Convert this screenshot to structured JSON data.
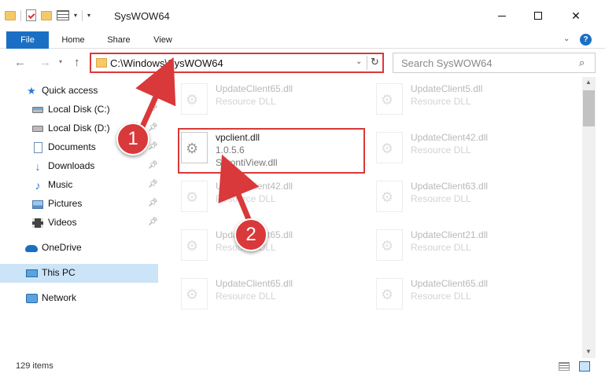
{
  "window": {
    "title": "SysWOW64",
    "controls": {
      "minimize": "minimize",
      "maximize": "maximize",
      "close": "✕"
    }
  },
  "ribbon": {
    "tabs": [
      {
        "label": "File",
        "active": true
      },
      {
        "label": "Home"
      },
      {
        "label": "Share"
      },
      {
        "label": "View"
      }
    ],
    "help_label": "?"
  },
  "navbar": {
    "back": "←",
    "forward": "→",
    "recent": "▾",
    "up": "↑",
    "address": "C:\\Windows\\SysWOW64",
    "address_dropdown": "⌄",
    "refresh": "↻",
    "search_placeholder": "Search SysWOW64",
    "search_icon": "⌕"
  },
  "sidebar": {
    "items": [
      {
        "label": "Quick access",
        "icon": "star-icon"
      },
      {
        "label": "Local Disk (C:)",
        "icon": "disk-icon",
        "pinned": true
      },
      {
        "label": "Local Disk (D:)",
        "icon": "disk-icon",
        "pinned": true
      },
      {
        "label": "Documents",
        "icon": "document-icon",
        "pinned": true
      },
      {
        "label": "Downloads",
        "icon": "download-icon",
        "pinned": true
      },
      {
        "label": "Music",
        "icon": "music-icon",
        "pinned": true
      },
      {
        "label": "Pictures",
        "icon": "pictures-icon",
        "pinned": true
      },
      {
        "label": "Videos",
        "icon": "video-icon",
        "pinned": true
      },
      {
        "label": "OneDrive",
        "icon": "cloud-icon"
      },
      {
        "label": "This PC",
        "icon": "computer-icon",
        "selected": true
      },
      {
        "label": "Network",
        "icon": "network-icon"
      }
    ]
  },
  "files": [
    {
      "name": "UpdateClient65.dll",
      "type": "Resource DLL",
      "faded": true
    },
    {
      "name": "UpdateClient5.dll",
      "type": "Resource DLL",
      "faded": true
    },
    {
      "name": "vpclient.dll",
      "type": "1.0.5.6",
      "desc": "SorontiView.dll",
      "faded": false
    },
    {
      "name": "UpdateClient42.dll",
      "type": "Resource DLL",
      "faded": true
    },
    {
      "name": "UpdateClient42.dll",
      "type": "Resource DLL",
      "faded": true
    },
    {
      "name": "UpdateClient63.dll",
      "type": "Resource DLL",
      "faded": true
    },
    {
      "name": "UpdateClient65.dll",
      "type": "Resource DLL",
      "faded": true
    },
    {
      "name": "UpdateClient21.dll",
      "type": "Resource DLL",
      "faded": true
    },
    {
      "name": "UpdateClient65.dll",
      "type": "Resource DLL",
      "faded": true
    },
    {
      "name": "UpdateClient65.dll",
      "type": "Resource DLL",
      "faded": true
    }
  ],
  "status": {
    "item_count": "129 items"
  },
  "annotations": {
    "step1": "1",
    "step2": "2",
    "color": "#d9393a"
  }
}
